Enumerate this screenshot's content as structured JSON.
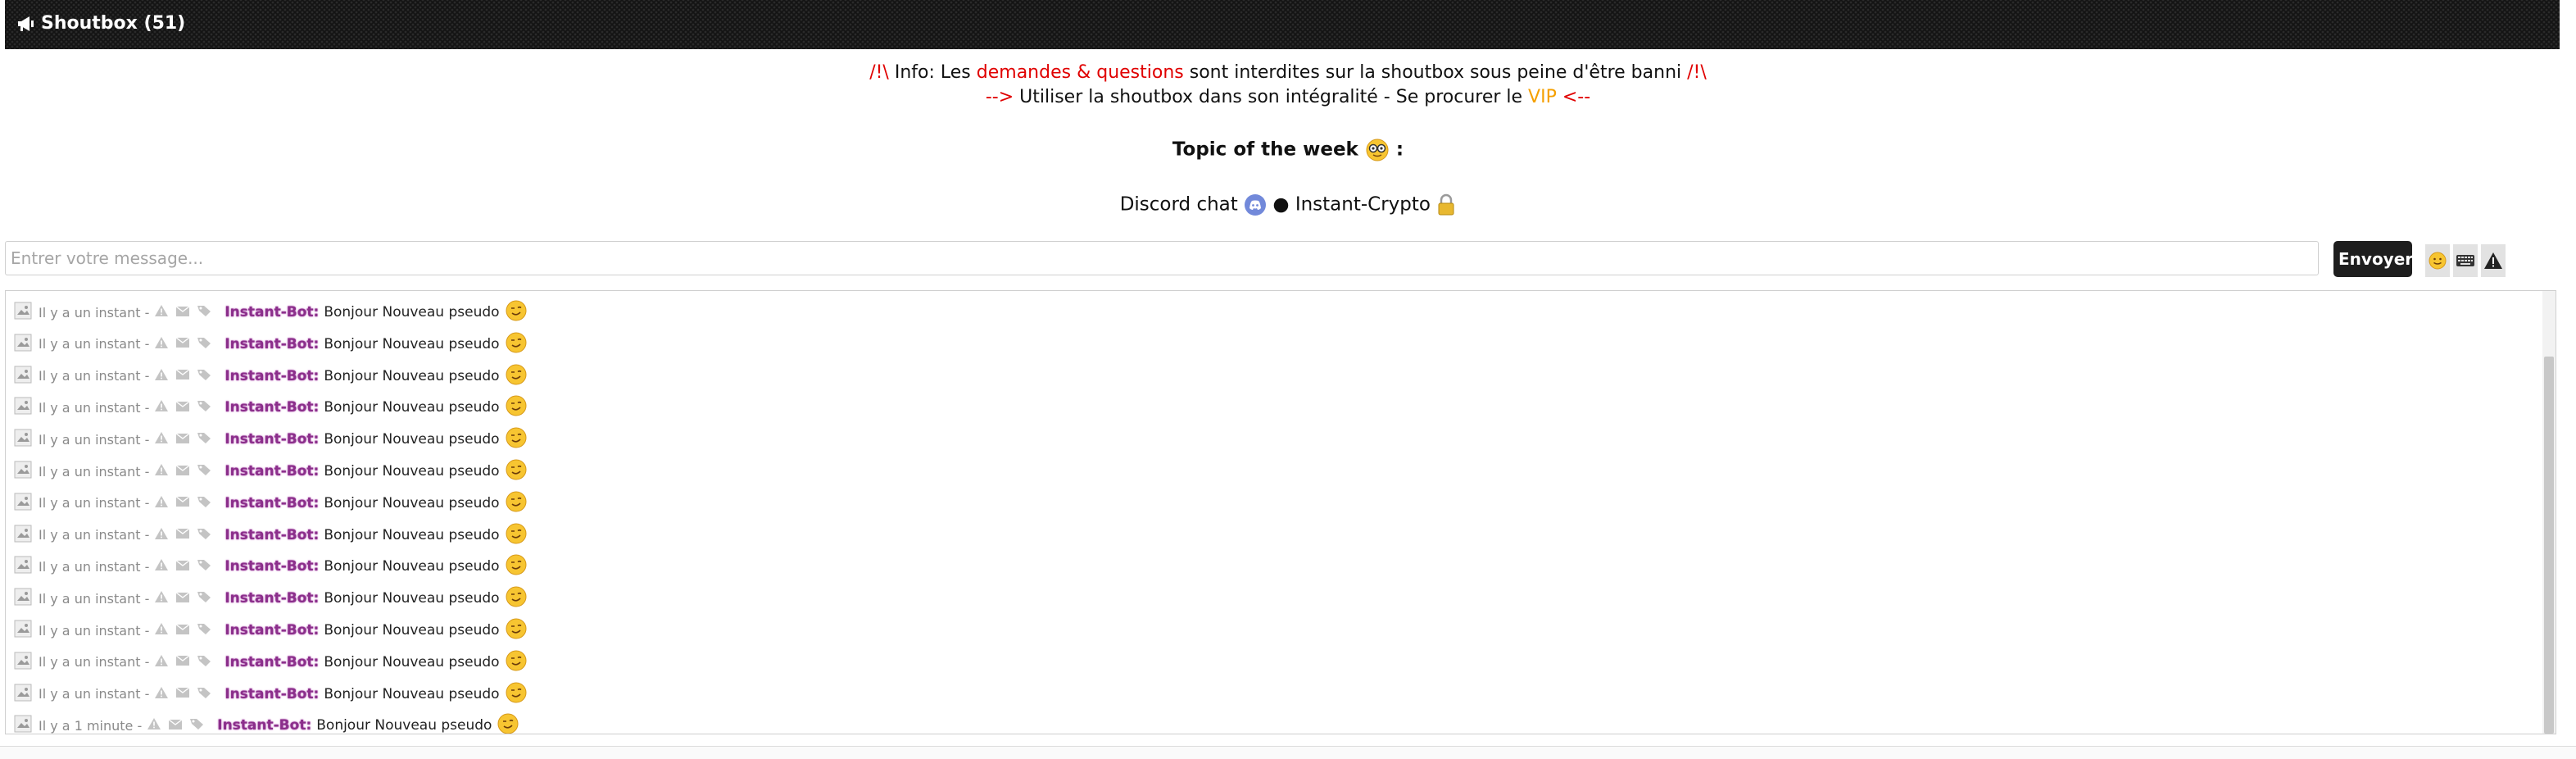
{
  "header": {
    "title": "Shoutbox (51)",
    "icon": "megaphone-icon",
    "background": "#141414"
  },
  "info": {
    "line1": {
      "prefix": "/!\\",
      "label": " Info: Les ",
      "highlight": "demandes & questions",
      "rest": " sont interdites sur la shoutbox sous peine d'être banni ",
      "suffix": "/!\\"
    },
    "line2": {
      "arrow_left": "-->",
      "text": " Utiliser la shoutbox dans son intégralité - Se procurer le ",
      "vip": "VIP",
      "arrow_right": " <--"
    },
    "colors": {
      "red": "#e00000",
      "orange": "#f5a000"
    }
  },
  "topic": {
    "label": "Topic of the week",
    "colon": " :",
    "icon": "nerd-emoji-icon"
  },
  "links": {
    "discord_label": "Discord chat",
    "discord_icon": "discord-icon",
    "separator": " ● ",
    "crypto_label": "Instant-Crypto",
    "crypto_icon": "lock-icon"
  },
  "composer": {
    "placeholder": "Entrer votre message...",
    "send_label": "Envoyer",
    "tools": [
      "emoji-icon",
      "keyboard-icon",
      "warning-icon"
    ]
  },
  "messages": [
    {
      "time": "Il y a un instant -",
      "user": "Instant-Bot:",
      "text": "Bonjour Nouveau pseudo"
    },
    {
      "time": "Il y a un instant -",
      "user": "Instant-Bot:",
      "text": "Bonjour Nouveau pseudo"
    },
    {
      "time": "Il y a un instant -",
      "user": "Instant-Bot:",
      "text": "Bonjour Nouveau pseudo"
    },
    {
      "time": "Il y a un instant -",
      "user": "Instant-Bot:",
      "text": "Bonjour Nouveau pseudo"
    },
    {
      "time": "Il y a un instant -",
      "user": "Instant-Bot:",
      "text": "Bonjour Nouveau pseudo"
    },
    {
      "time": "Il y a un instant -",
      "user": "Instant-Bot:",
      "text": "Bonjour Nouveau pseudo"
    },
    {
      "time": "Il y a un instant -",
      "user": "Instant-Bot:",
      "text": "Bonjour Nouveau pseudo"
    },
    {
      "time": "Il y a un instant -",
      "user": "Instant-Bot:",
      "text": "Bonjour Nouveau pseudo"
    },
    {
      "time": "Il y a un instant -",
      "user": "Instant-Bot:",
      "text": "Bonjour Nouveau pseudo"
    },
    {
      "time": "Il y a un instant -",
      "user": "Instant-Bot:",
      "text": "Bonjour Nouveau pseudo"
    },
    {
      "time": "Il y a un instant -",
      "user": "Instant-Bot:",
      "text": "Bonjour Nouveau pseudo"
    },
    {
      "time": "Il y a un instant -",
      "user": "Instant-Bot:",
      "text": "Bonjour Nouveau pseudo"
    },
    {
      "time": "Il y a un instant -",
      "user": "Instant-Bot:",
      "text": "Bonjour Nouveau pseudo"
    },
    {
      "time": "Il y a 1 minute -",
      "user": "Instant-Bot:",
      "text": "Bonjour Nouveau pseudo"
    }
  ]
}
